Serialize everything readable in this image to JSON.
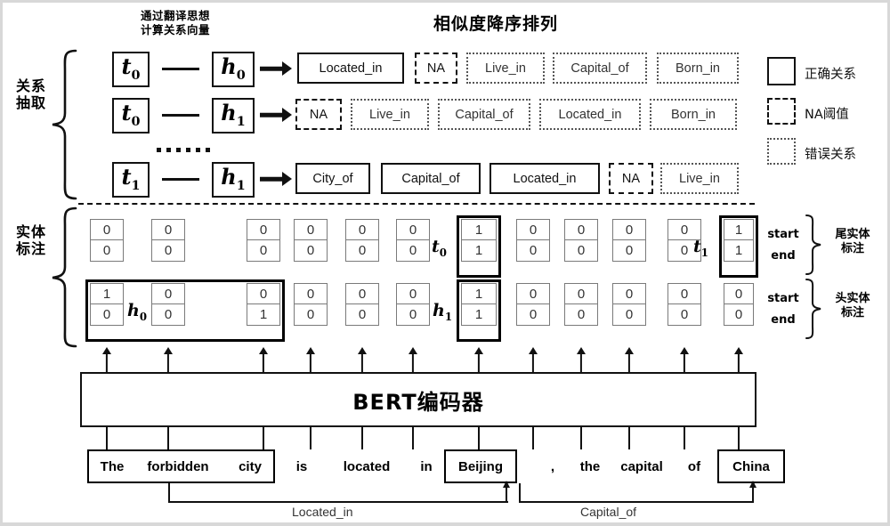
{
  "headers": {
    "translate_note_line1": "通过翻译思想",
    "translate_note_line2": "计算关系向量",
    "similarity_title": "相似度降序排列"
  },
  "side_labels": {
    "relation_extraction": "关系抽取",
    "entity_tagging": "实体标注"
  },
  "right_labels": {
    "start": "start",
    "end": "end",
    "tail_entity_tagging_l1": "尾实体",
    "tail_entity_tagging_l2": "标注",
    "head_entity_tagging_l1": "头实体",
    "head_entity_tagging_l2": "标注"
  },
  "legend": [
    {
      "name": "correct-relation",
      "style": "solid",
      "label": "正确关系"
    },
    {
      "name": "na-threshold",
      "style": "dashed",
      "label": "NA阈值"
    },
    {
      "name": "wrong-relation",
      "style": "dotted",
      "label": "错误关系"
    }
  ],
  "relation_rows": [
    {
      "tail": "t",
      "tail_sub": "0",
      "head": "h",
      "head_sub": "0",
      "candidates": [
        {
          "label": "Located_in",
          "style": "solid"
        },
        {
          "label": "NA",
          "style": "dashed"
        },
        {
          "label": "Live_in",
          "style": "dotted"
        },
        {
          "label": "Capital_of",
          "style": "dotted"
        },
        {
          "label": "Born_in",
          "style": "dotted"
        }
      ]
    },
    {
      "tail": "t",
      "tail_sub": "0",
      "head": "h",
      "head_sub": "1",
      "candidates": [
        {
          "label": "NA",
          "style": "dashed"
        },
        {
          "label": "Live_in",
          "style": "dotted"
        },
        {
          "label": "Capital_of",
          "style": "dotted"
        },
        {
          "label": "Located_in",
          "style": "dotted"
        },
        {
          "label": "Born_in",
          "style": "dotted"
        }
      ]
    },
    {
      "tail": "t",
      "tail_sub": "1",
      "head": "h",
      "head_sub": "1",
      "candidates": [
        {
          "label": "City_of",
          "style": "solid"
        },
        {
          "label": "Capital_of",
          "style": "solid"
        },
        {
          "label": "Located_in",
          "style": "solid"
        },
        {
          "label": "NA",
          "style": "dashed"
        },
        {
          "label": "Live_in",
          "style": "dotted"
        }
      ]
    }
  ],
  "tagging": {
    "tail_row_label": "t",
    "head_row_label": "h",
    "tail_start": [
      0,
      0,
      0,
      0,
      0,
      0,
      1,
      0,
      0,
      0,
      0,
      1
    ],
    "tail_end": [
      0,
      0,
      0,
      0,
      0,
      0,
      1,
      0,
      0,
      0,
      0,
      1
    ],
    "head_start": [
      1,
      0,
      0,
      0,
      0,
      0,
      1,
      0,
      0,
      0,
      0,
      0
    ],
    "head_end": [
      0,
      0,
      1,
      0,
      0,
      0,
      1,
      0,
      0,
      0,
      0,
      0
    ],
    "markers": {
      "t0": "t",
      "t0_sub": "0",
      "t1": "t",
      "t1_sub": "1",
      "h0": "h",
      "h0_sub": "0",
      "h1": "h",
      "h1_sub": "1"
    }
  },
  "encoder": {
    "label": "BERT编码器"
  },
  "sentence": {
    "tokens": [
      "The",
      "forbidden",
      "city",
      "is",
      "located",
      "in",
      "Beijing",
      ",",
      "the",
      "capital",
      "of",
      "China"
    ],
    "entity_spans": [
      {
        "name": "the-forbidden-city",
        "from": 0,
        "to": 2
      },
      {
        "name": "beijing",
        "from": 6,
        "to": 6
      },
      {
        "name": "china",
        "from": 11,
        "to": 11
      }
    ]
  },
  "sentence_relations": [
    {
      "name": "located-in-link",
      "label": "Located_in"
    },
    {
      "name": "capital-of-link",
      "label": "Capital_of"
    }
  ]
}
